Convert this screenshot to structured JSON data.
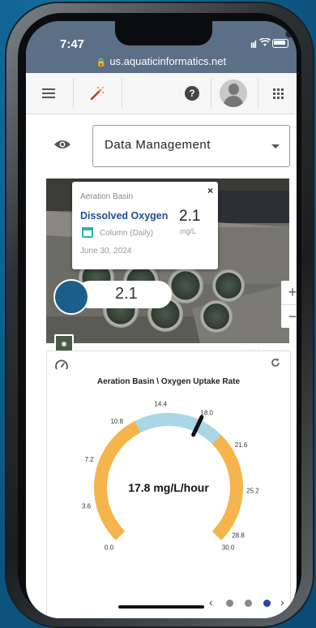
{
  "status": {
    "time": "7:47",
    "signal": "ııl"
  },
  "browser": {
    "url": "us.aquaticinformatics.net"
  },
  "toolbar": {
    "help_label": "?"
  },
  "view_selector": {
    "selected": "Data Management"
  },
  "map": {
    "popup": {
      "location": "Aeration Basin",
      "parameter": "Dissolved Oxygen",
      "value": "2.1",
      "unit": "mg/L",
      "column": "Column (Daily)",
      "date": "June 30, 2024",
      "close_label": "×"
    },
    "marker_value": "2.1",
    "zoom_in": "+",
    "zoom_out": "−",
    "attribution": "©2024 Vexcel"
  },
  "gauge_card": {
    "title": "Aeration Basin \\ Oxygen Uptake Rate",
    "readout": "17.8 mg/L/hour",
    "value": 17.8,
    "min": 0.0,
    "max": 30.0,
    "ticks": [
      "0.0",
      "3.6",
      "7.2",
      "10.8",
      "14.4",
      "18.0",
      "21.6",
      "25.2",
      "28.8",
      "30.0"
    ],
    "ranges": [
      {
        "from": 0.0,
        "to": 12.0,
        "color": "#f6b44c"
      },
      {
        "from": 12.0,
        "to": 20.0,
        "color": "#a9d7e6"
      },
      {
        "from": 20.0,
        "to": 30.0,
        "color": "#f6b44c"
      }
    ],
    "pager": {
      "prev": "‹",
      "next": "›",
      "count": 3,
      "active": 2
    }
  }
}
